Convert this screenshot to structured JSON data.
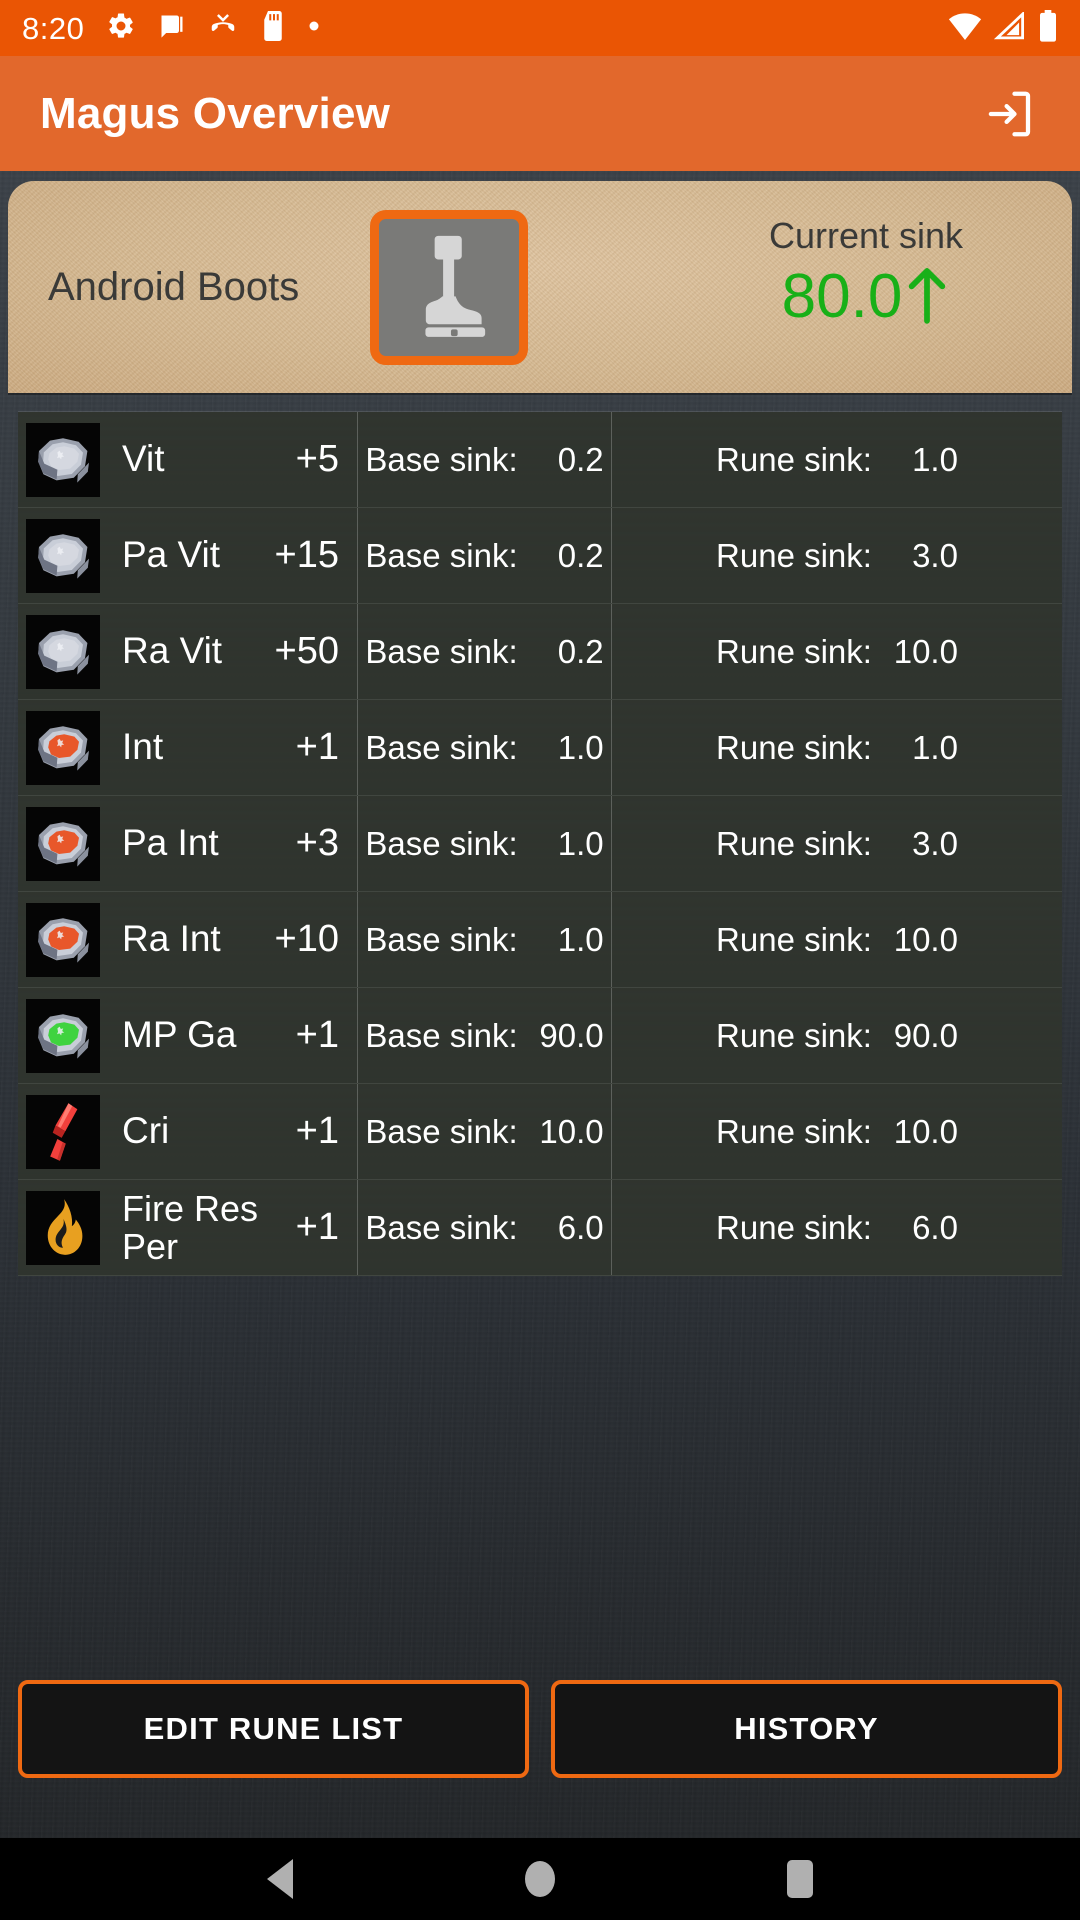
{
  "status_bar": {
    "time": "8:20",
    "left_icons": [
      "gear-icon",
      "message-list-icon",
      "missed-call-icon",
      "sd-card-icon",
      "dot-icon"
    ],
    "right_icons": [
      "wifi-icon",
      "cell-signal-icon",
      "battery-icon"
    ],
    "background_color": "#ea5504"
  },
  "app_bar": {
    "title": "Magus Overview",
    "action_icon": "exit-to-app-icon",
    "background_color": "#e2682c"
  },
  "item_card": {
    "name": "Android Boots",
    "thumbnail_icon": "boot-icon",
    "thumbnail_border_color": "#ef6912",
    "sink_label": "Current sink",
    "sink_value": "80.0",
    "sink_trend_icon": "arrow-up-icon",
    "sink_value_color": "#18b018"
  },
  "table": {
    "base_sink_key": "Base sink:",
    "rune_sink_key": "Rune sink:",
    "rows": [
      {
        "icon": "rune-stone-white-icon",
        "icon_color": "#d5d8e0",
        "name": "Vit",
        "bonus": "+5",
        "base_sink": "0.2",
        "rune_sink": "1.0"
      },
      {
        "icon": "rune-stone-white-icon",
        "icon_color": "#d5d8e0",
        "name": "Pa Vit",
        "bonus": "+15",
        "base_sink": "0.2",
        "rune_sink": "3.0"
      },
      {
        "icon": "rune-stone-white-icon",
        "icon_color": "#d5d8e0",
        "name": "Ra Vit",
        "bonus": "+50",
        "base_sink": "0.2",
        "rune_sink": "10.0"
      },
      {
        "icon": "rune-stone-red-icon",
        "icon_color": "#e8572a",
        "name": "Int",
        "bonus": "+1",
        "base_sink": "1.0",
        "rune_sink": "1.0"
      },
      {
        "icon": "rune-stone-red-icon",
        "icon_color": "#e8572a",
        "name": "Pa Int",
        "bonus": "+3",
        "base_sink": "1.0",
        "rune_sink": "3.0"
      },
      {
        "icon": "rune-stone-red-icon",
        "icon_color": "#e8572a",
        "name": "Ra Int",
        "bonus": "+10",
        "base_sink": "1.0",
        "rune_sink": "10.0"
      },
      {
        "icon": "rune-stone-green-icon",
        "icon_color": "#3fd33f",
        "name": "MP Ga",
        "bonus": "+1",
        "base_sink": "90.0",
        "rune_sink": "90.0"
      },
      {
        "icon": "crystal-red-icon",
        "icon_color": "#f2403c",
        "name": "Cri",
        "bonus": "+1",
        "base_sink": "10.0",
        "rune_sink": "10.0"
      },
      {
        "icon": "flame-icon",
        "icon_color": "#e8a020",
        "name": "Fire Res Per",
        "bonus": "+1",
        "base_sink": "6.0",
        "rune_sink": "6.0"
      }
    ]
  },
  "buttons": {
    "edit_rune_list": "EDIT RUNE LIST",
    "history": "HISTORY",
    "border_color": "#ef6912"
  },
  "nav_bar": {
    "back_icon": "triangle-back-icon",
    "home_icon": "circle-home-icon",
    "recents_icon": "square-recents-icon"
  }
}
